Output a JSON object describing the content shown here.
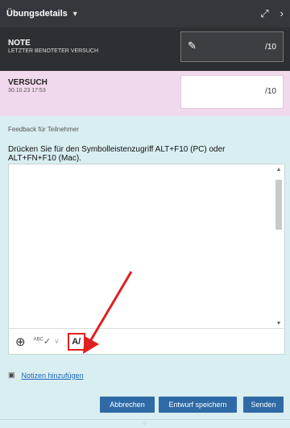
{
  "header": {
    "title": "Übungsdetails",
    "expand_icon": "expand-icon",
    "next_icon": "chevron-right-icon"
  },
  "grade": {
    "label": "NOTE",
    "sublabel": "LETZTER BENOTETER VERSUCH",
    "value": "",
    "denominator": "/10"
  },
  "attempt": {
    "label": "VERSUCH",
    "timestamp": "30.10.23 17:53",
    "value": "",
    "denominator": "/10"
  },
  "feedback": {
    "label": "Feedback für Teilnehmer",
    "hint": "Drücken Sie für den Symbolleistenzugriff ALT+F10 (PC) oder ALT+FN+F10 (Mac).",
    "text": ""
  },
  "toolbar": {
    "add_icon": "plus-circle-icon",
    "spellcheck_label": "ABC",
    "font_icon": "text-format-icon",
    "font_label": "A"
  },
  "notes": {
    "label": "Notizen hinzufügen"
  },
  "actions": {
    "cancel": "Abbrechen",
    "save_draft": "Entwurf speichern",
    "send": "Senden"
  },
  "colors": {
    "header_bg": "#34383c",
    "attempt_bg": "#f1d9ed",
    "panel_bg": "#d9eef0",
    "button_bg": "#2e6aa5",
    "highlight": "#e02020",
    "link": "#1c67b8"
  }
}
